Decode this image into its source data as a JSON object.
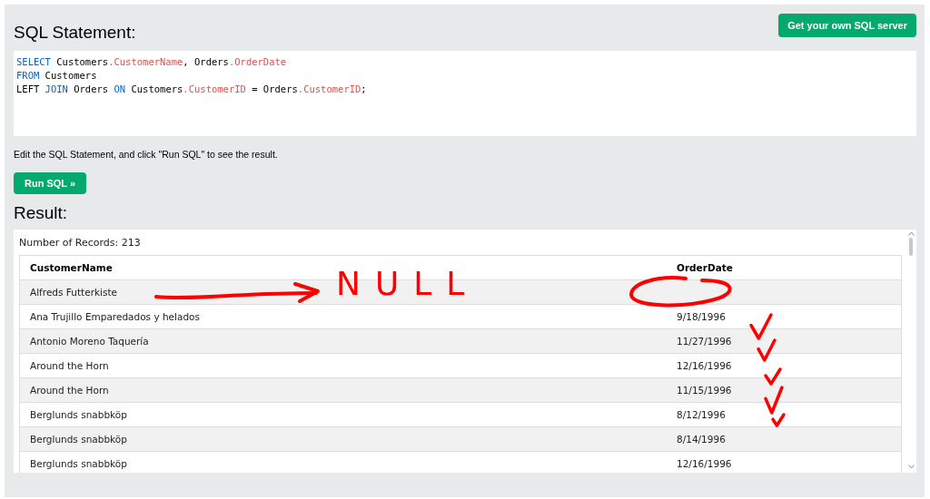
{
  "header": {
    "title": "SQL Statement:",
    "server_button": "Get your own SQL server"
  },
  "editor": {
    "lines": [
      [
        {
          "kind": "keyword",
          "text": "SELECT"
        },
        {
          "kind": "plain",
          "text": " Customers"
        },
        {
          "kind": "property",
          "text": ".CustomerName"
        },
        {
          "kind": "plain",
          "text": ", Orders"
        },
        {
          "kind": "property",
          "text": ".OrderDate"
        }
      ],
      [
        {
          "kind": "keyword",
          "text": "FROM"
        },
        {
          "kind": "plain",
          "text": " Customers"
        }
      ],
      [
        {
          "kind": "plain",
          "text": "LEFT "
        },
        {
          "kind": "keyword",
          "text": "JOIN"
        },
        {
          "kind": "plain",
          "text": " Orders "
        },
        {
          "kind": "keyword",
          "text": "ON"
        },
        {
          "kind": "plain",
          "text": " Customers"
        },
        {
          "kind": "property",
          "text": ".CustomerID"
        },
        {
          "kind": "plain",
          "text": " = Orders"
        },
        {
          "kind": "property",
          "text": ".CustomerID"
        },
        {
          "kind": "plain",
          "text": ";"
        }
      ]
    ]
  },
  "hint": "Edit the SQL Statement, and click \"Run SQL\" to see the result.",
  "run_button": "Run SQL »",
  "result": {
    "title": "Result:",
    "record_count": "Number of Records: 213",
    "table": {
      "columns": [
        "CustomerName",
        "OrderDate"
      ],
      "rows": [
        [
          "Alfreds Futterkiste",
          ""
        ],
        [
          "Ana Trujillo Emparedados y helados",
          "9/18/1996"
        ],
        [
          "Antonio Moreno Taquería",
          "11/27/1996"
        ],
        [
          "Around the Horn",
          "12/16/1996"
        ],
        [
          "Around the Horn",
          "11/15/1996"
        ],
        [
          "Berglunds snabbköp",
          "8/12/1996"
        ],
        [
          "Berglunds snabbköp",
          "8/14/1996"
        ],
        [
          "Berglunds snabbköp",
          "12/16/1996"
        ]
      ]
    }
  },
  "annotation": {
    "text": "NULL"
  }
}
